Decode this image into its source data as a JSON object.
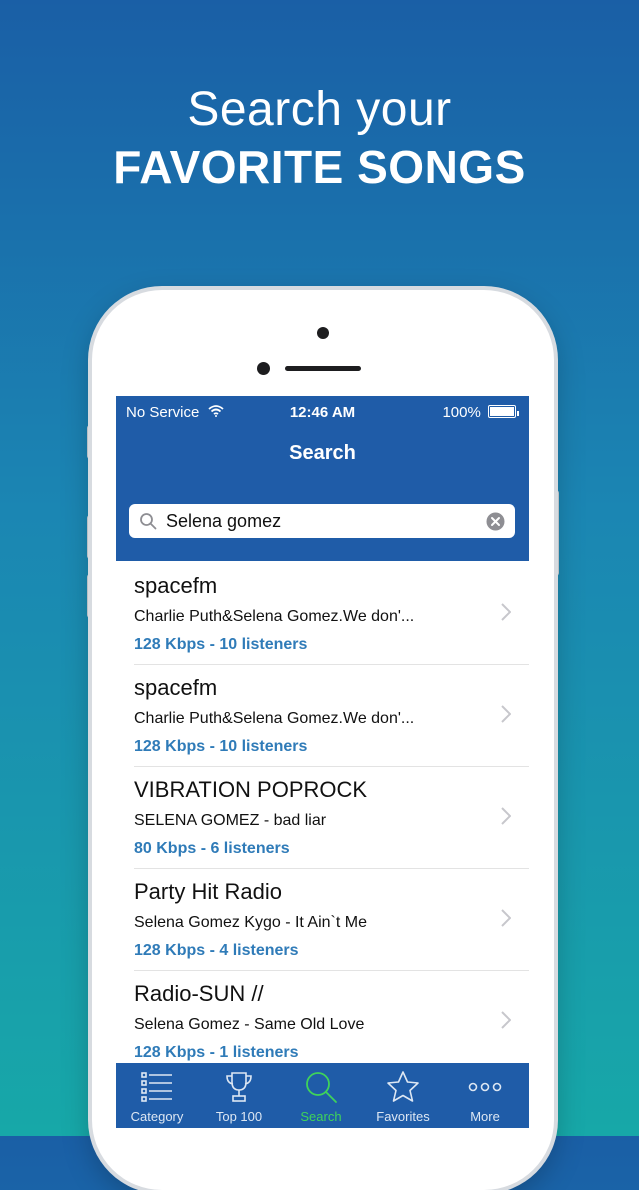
{
  "promo": {
    "line1": "Search your",
    "line2": "FAVORITE SONGS"
  },
  "status_bar": {
    "carrier": "No Service",
    "time": "12:46 AM",
    "battery": "100%"
  },
  "nav": {
    "title": "Search"
  },
  "search": {
    "value": "Selena gomez"
  },
  "results": [
    {
      "station": "spacefm",
      "song": "Charlie Puth&Selena Gomez.We don'...",
      "meta": "128 Kbps - 10 listeners"
    },
    {
      "station": "spacefm",
      "song": "Charlie Puth&Selena Gomez.We don'...",
      "meta": "128 Kbps - 10 listeners"
    },
    {
      "station": "VIBRATION POPROCK",
      "song": "SELENA GOMEZ - bad liar",
      "meta": "80 Kbps - 6 listeners"
    },
    {
      "station": "Party Hit Radio",
      "song": "Selena Gomez Kygo - It Ain`t Me",
      "meta": "128 Kbps - 4 listeners"
    },
    {
      "station": "Radio-SUN //",
      "song": "Selena Gomez - Same Old Love",
      "meta": "128 Kbps - 1 listeners"
    }
  ],
  "tabs": [
    {
      "label": "Category",
      "icon": "list-icon"
    },
    {
      "label": "Top 100",
      "icon": "trophy-icon"
    },
    {
      "label": "Search",
      "icon": "search-icon",
      "active": true
    },
    {
      "label": "Favorites",
      "icon": "star-icon"
    },
    {
      "label": "More",
      "icon": "more-icon"
    }
  ],
  "colors": {
    "nav_blue": "#1f5ca8",
    "meta_blue": "#2f7bb8",
    "active_tab": "#3fd35a"
  }
}
